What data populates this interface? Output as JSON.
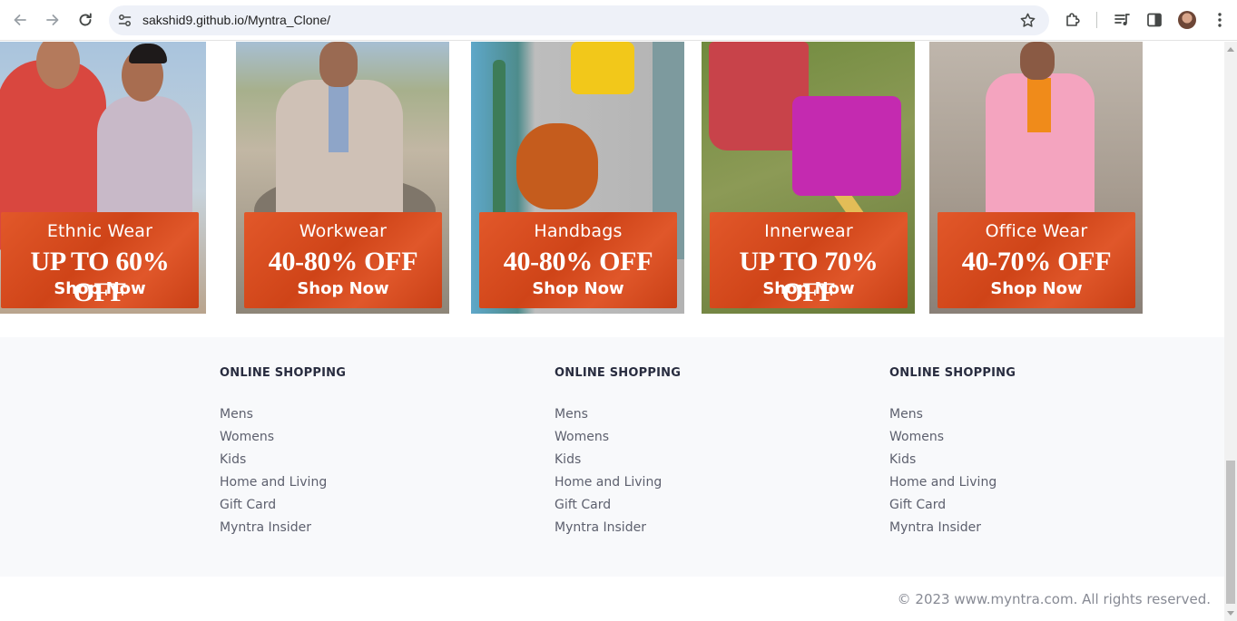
{
  "browser": {
    "url": "sakshid9.github.io/Myntra_Clone/"
  },
  "tiles": [
    {
      "name": "Ethnic Wear",
      "offer": "UP TO 60% OFF",
      "cta": "Shop Now"
    },
    {
      "name": "Workwear",
      "offer": "40-80% OFF",
      "cta": "Shop Now"
    },
    {
      "name": "Handbags",
      "offer": "40-80% OFF",
      "cta": "Shop Now"
    },
    {
      "name": "Innerwear",
      "offer": "UP TO 70% OFF",
      "cta": "Shop Now"
    },
    {
      "name": "Office Wear",
      "offer": "40-70% OFF",
      "cta": "Shop Now"
    }
  ],
  "footer": {
    "columns": [
      {
        "title": "ONLINE SHOPPING",
        "links": [
          "Mens",
          "Womens",
          "Kids",
          "Home and Living",
          "Gift Card",
          "Myntra Insider"
        ]
      },
      {
        "title": "ONLINE SHOPPING",
        "links": [
          "Mens",
          "Womens",
          "Kids",
          "Home and Living",
          "Gift Card",
          "Myntra Insider"
        ]
      },
      {
        "title": "ONLINE SHOPPING",
        "links": [
          "Mens",
          "Womens",
          "Kids",
          "Home and Living",
          "Gift Card",
          "Myntra Insider"
        ]
      }
    ],
    "copyright": "© 2023 www.myntra.com. All rights reserved."
  },
  "colors": {
    "offer_orange": "#d44a1c",
    "footer_bg": "#f8f9fb",
    "heading": "#282c3f",
    "link": "#5d606e"
  }
}
